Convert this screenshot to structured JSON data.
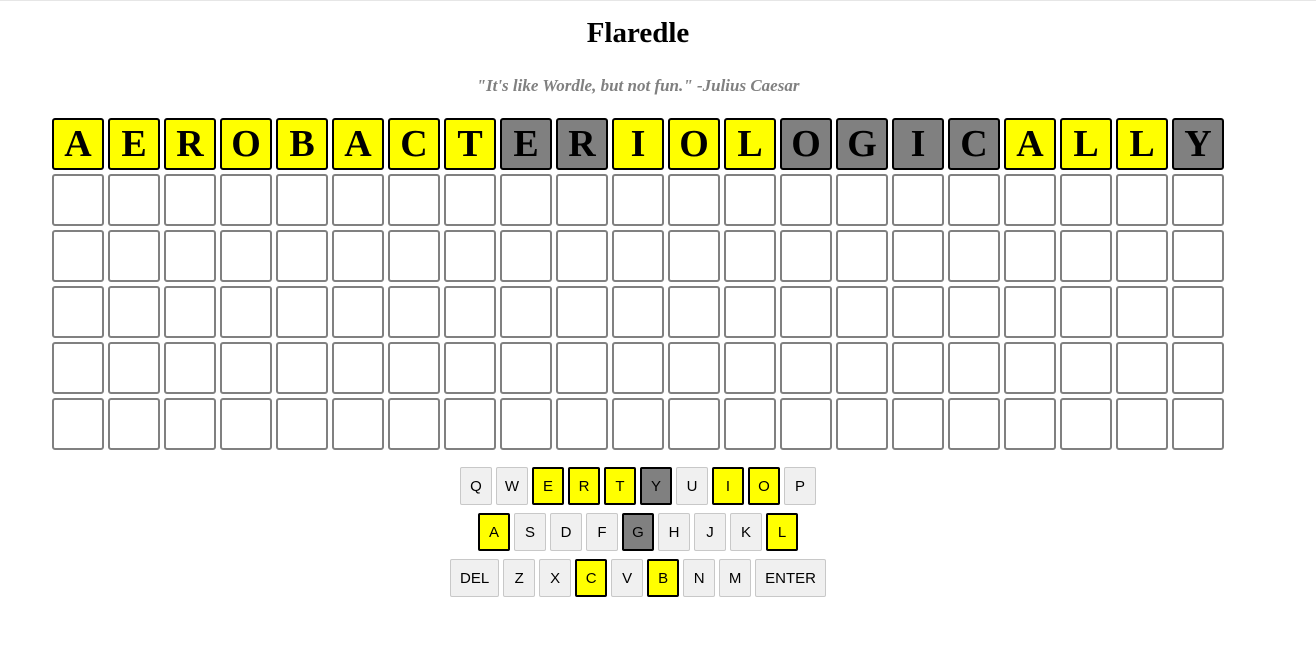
{
  "title": "Flaredle",
  "subtitle": "\"It's like Wordle, but not fun.\" -Julius Caesar",
  "colors": {
    "present": "#ffff00",
    "absent": "#808080",
    "empty": "#ffffff"
  },
  "board": {
    "rows": [
      {
        "tiles": [
          {
            "letter": "A",
            "state": "present"
          },
          {
            "letter": "E",
            "state": "present"
          },
          {
            "letter": "R",
            "state": "present"
          },
          {
            "letter": "O",
            "state": "present"
          },
          {
            "letter": "B",
            "state": "present"
          },
          {
            "letter": "A",
            "state": "present"
          },
          {
            "letter": "C",
            "state": "present"
          },
          {
            "letter": "T",
            "state": "present"
          },
          {
            "letter": "E",
            "state": "absent"
          },
          {
            "letter": "R",
            "state": "absent"
          },
          {
            "letter": "I",
            "state": "present"
          },
          {
            "letter": "O",
            "state": "present"
          },
          {
            "letter": "L",
            "state": "present"
          },
          {
            "letter": "O",
            "state": "absent"
          },
          {
            "letter": "G",
            "state": "absent"
          },
          {
            "letter": "I",
            "state": "absent"
          },
          {
            "letter": "C",
            "state": "absent"
          },
          {
            "letter": "A",
            "state": "present"
          },
          {
            "letter": "L",
            "state": "present"
          },
          {
            "letter": "L",
            "state": "present"
          },
          {
            "letter": "Y",
            "state": "absent"
          }
        ]
      },
      {
        "tiles": [
          {
            "letter": "",
            "state": "empty"
          },
          {
            "letter": "",
            "state": "empty"
          },
          {
            "letter": "",
            "state": "empty"
          },
          {
            "letter": "",
            "state": "empty"
          },
          {
            "letter": "",
            "state": "empty"
          },
          {
            "letter": "",
            "state": "empty"
          },
          {
            "letter": "",
            "state": "empty"
          },
          {
            "letter": "",
            "state": "empty"
          },
          {
            "letter": "",
            "state": "empty"
          },
          {
            "letter": "",
            "state": "empty"
          },
          {
            "letter": "",
            "state": "empty"
          },
          {
            "letter": "",
            "state": "empty"
          },
          {
            "letter": "",
            "state": "empty"
          },
          {
            "letter": "",
            "state": "empty"
          },
          {
            "letter": "",
            "state": "empty"
          },
          {
            "letter": "",
            "state": "empty"
          },
          {
            "letter": "",
            "state": "empty"
          },
          {
            "letter": "",
            "state": "empty"
          },
          {
            "letter": "",
            "state": "empty"
          },
          {
            "letter": "",
            "state": "empty"
          },
          {
            "letter": "",
            "state": "empty"
          }
        ]
      },
      {
        "tiles": [
          {
            "letter": "",
            "state": "empty"
          },
          {
            "letter": "",
            "state": "empty"
          },
          {
            "letter": "",
            "state": "empty"
          },
          {
            "letter": "",
            "state": "empty"
          },
          {
            "letter": "",
            "state": "empty"
          },
          {
            "letter": "",
            "state": "empty"
          },
          {
            "letter": "",
            "state": "empty"
          },
          {
            "letter": "",
            "state": "empty"
          },
          {
            "letter": "",
            "state": "empty"
          },
          {
            "letter": "",
            "state": "empty"
          },
          {
            "letter": "",
            "state": "empty"
          },
          {
            "letter": "",
            "state": "empty"
          },
          {
            "letter": "",
            "state": "empty"
          },
          {
            "letter": "",
            "state": "empty"
          },
          {
            "letter": "",
            "state": "empty"
          },
          {
            "letter": "",
            "state": "empty"
          },
          {
            "letter": "",
            "state": "empty"
          },
          {
            "letter": "",
            "state": "empty"
          },
          {
            "letter": "",
            "state": "empty"
          },
          {
            "letter": "",
            "state": "empty"
          },
          {
            "letter": "",
            "state": "empty"
          }
        ]
      },
      {
        "tiles": [
          {
            "letter": "",
            "state": "empty"
          },
          {
            "letter": "",
            "state": "empty"
          },
          {
            "letter": "",
            "state": "empty"
          },
          {
            "letter": "",
            "state": "empty"
          },
          {
            "letter": "",
            "state": "empty"
          },
          {
            "letter": "",
            "state": "empty"
          },
          {
            "letter": "",
            "state": "empty"
          },
          {
            "letter": "",
            "state": "empty"
          },
          {
            "letter": "",
            "state": "empty"
          },
          {
            "letter": "",
            "state": "empty"
          },
          {
            "letter": "",
            "state": "empty"
          },
          {
            "letter": "",
            "state": "empty"
          },
          {
            "letter": "",
            "state": "empty"
          },
          {
            "letter": "",
            "state": "empty"
          },
          {
            "letter": "",
            "state": "empty"
          },
          {
            "letter": "",
            "state": "empty"
          },
          {
            "letter": "",
            "state": "empty"
          },
          {
            "letter": "",
            "state": "empty"
          },
          {
            "letter": "",
            "state": "empty"
          },
          {
            "letter": "",
            "state": "empty"
          },
          {
            "letter": "",
            "state": "empty"
          }
        ]
      },
      {
        "tiles": [
          {
            "letter": "",
            "state": "empty"
          },
          {
            "letter": "",
            "state": "empty"
          },
          {
            "letter": "",
            "state": "empty"
          },
          {
            "letter": "",
            "state": "empty"
          },
          {
            "letter": "",
            "state": "empty"
          },
          {
            "letter": "",
            "state": "empty"
          },
          {
            "letter": "",
            "state": "empty"
          },
          {
            "letter": "",
            "state": "empty"
          },
          {
            "letter": "",
            "state": "empty"
          },
          {
            "letter": "",
            "state": "empty"
          },
          {
            "letter": "",
            "state": "empty"
          },
          {
            "letter": "",
            "state": "empty"
          },
          {
            "letter": "",
            "state": "empty"
          },
          {
            "letter": "",
            "state": "empty"
          },
          {
            "letter": "",
            "state": "empty"
          },
          {
            "letter": "",
            "state": "empty"
          },
          {
            "letter": "",
            "state": "empty"
          },
          {
            "letter": "",
            "state": "empty"
          },
          {
            "letter": "",
            "state": "empty"
          },
          {
            "letter": "",
            "state": "empty"
          },
          {
            "letter": "",
            "state": "empty"
          }
        ]
      },
      {
        "tiles": [
          {
            "letter": "",
            "state": "empty"
          },
          {
            "letter": "",
            "state": "empty"
          },
          {
            "letter": "",
            "state": "empty"
          },
          {
            "letter": "",
            "state": "empty"
          },
          {
            "letter": "",
            "state": "empty"
          },
          {
            "letter": "",
            "state": "empty"
          },
          {
            "letter": "",
            "state": "empty"
          },
          {
            "letter": "",
            "state": "empty"
          },
          {
            "letter": "",
            "state": "empty"
          },
          {
            "letter": "",
            "state": "empty"
          },
          {
            "letter": "",
            "state": "empty"
          },
          {
            "letter": "",
            "state": "empty"
          },
          {
            "letter": "",
            "state": "empty"
          },
          {
            "letter": "",
            "state": "empty"
          },
          {
            "letter": "",
            "state": "empty"
          },
          {
            "letter": "",
            "state": "empty"
          },
          {
            "letter": "",
            "state": "empty"
          },
          {
            "letter": "",
            "state": "empty"
          },
          {
            "letter": "",
            "state": "empty"
          },
          {
            "letter": "",
            "state": "empty"
          },
          {
            "letter": "",
            "state": "empty"
          }
        ]
      }
    ]
  },
  "keyboard": {
    "rows": [
      [
        {
          "label": "Q",
          "state": "unused"
        },
        {
          "label": "W",
          "state": "unused"
        },
        {
          "label": "E",
          "state": "present"
        },
        {
          "label": "R",
          "state": "present"
        },
        {
          "label": "T",
          "state": "present"
        },
        {
          "label": "Y",
          "state": "absent"
        },
        {
          "label": "U",
          "state": "unused"
        },
        {
          "label": "I",
          "state": "present"
        },
        {
          "label": "O",
          "state": "present"
        },
        {
          "label": "P",
          "state": "unused"
        }
      ],
      [
        {
          "label": "A",
          "state": "present"
        },
        {
          "label": "S",
          "state": "unused"
        },
        {
          "label": "D",
          "state": "unused"
        },
        {
          "label": "F",
          "state": "unused"
        },
        {
          "label": "G",
          "state": "absent"
        },
        {
          "label": "H",
          "state": "unused"
        },
        {
          "label": "J",
          "state": "unused"
        },
        {
          "label": "K",
          "state": "unused"
        },
        {
          "label": "L",
          "state": "present"
        }
      ],
      [
        {
          "label": "DEL",
          "state": "unused",
          "wide": true
        },
        {
          "label": "Z",
          "state": "unused"
        },
        {
          "label": "X",
          "state": "unused"
        },
        {
          "label": "C",
          "state": "present"
        },
        {
          "label": "V",
          "state": "unused"
        },
        {
          "label": "B",
          "state": "present"
        },
        {
          "label": "N",
          "state": "unused"
        },
        {
          "label": "M",
          "state": "unused"
        },
        {
          "label": "ENTER",
          "state": "unused",
          "wide": true
        }
      ]
    ]
  }
}
